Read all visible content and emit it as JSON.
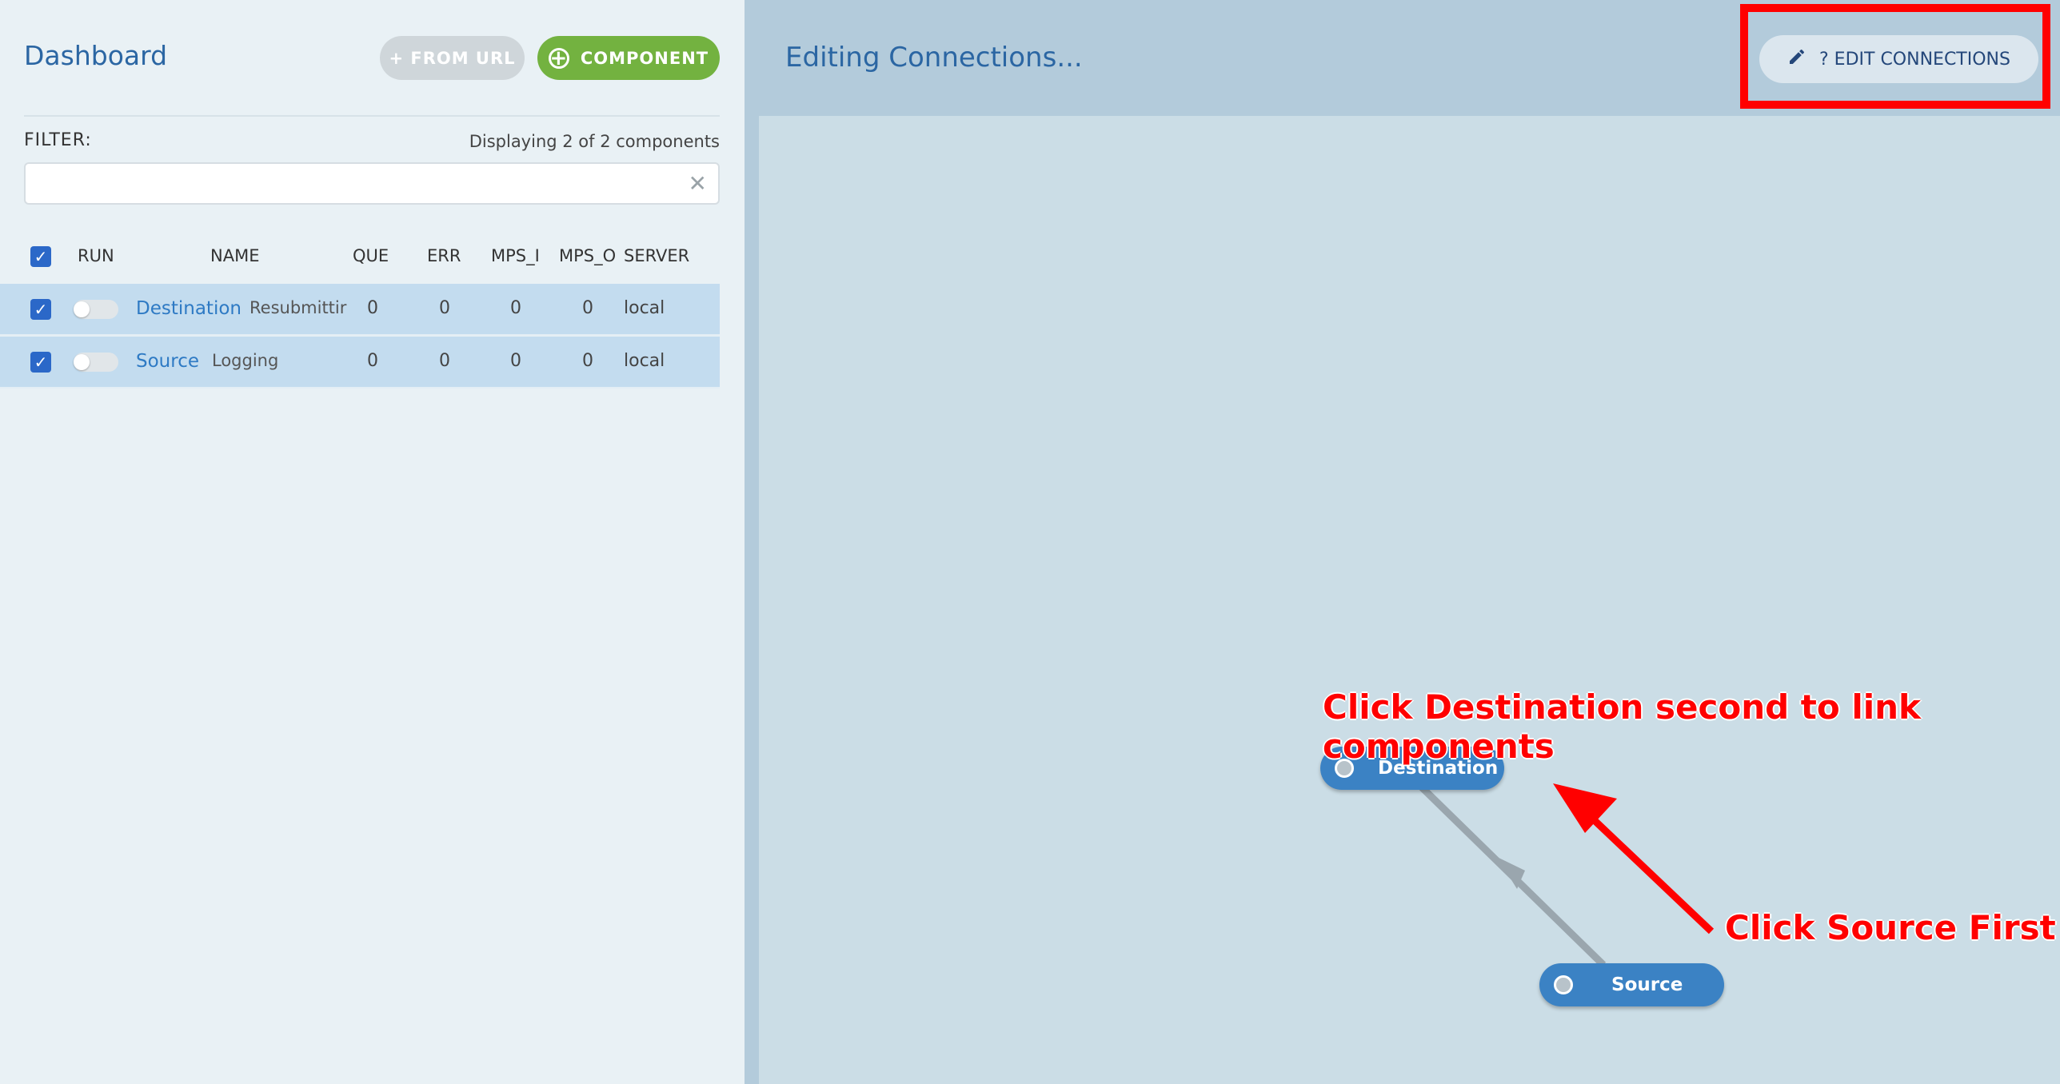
{
  "sidebar": {
    "title": "Dashboard",
    "from_url_label": "+ FROM URL",
    "component_label": "COMPONENT",
    "filter_label": "FILTER:",
    "display_count": "Displaying 2 of 2 components",
    "filter_value": ""
  },
  "table": {
    "headers": {
      "run": "RUN",
      "name": "NAME",
      "que": "QUE",
      "err": "ERR",
      "mps_i": "MPS_I",
      "mps_o": "MPS_O",
      "server": "SERVER"
    },
    "rows": [
      {
        "name": "Destination",
        "type": "Resubmittir",
        "que": "0",
        "err": "0",
        "mps_i": "0",
        "mps_o": "0",
        "server": "local",
        "checked": true,
        "running": false
      },
      {
        "name": "Source",
        "type": "Logging",
        "que": "0",
        "err": "0",
        "mps_i": "0",
        "mps_o": "0",
        "server": "local",
        "checked": true,
        "running": false
      }
    ]
  },
  "main": {
    "title": "Editing Connections...",
    "edit_button_label": "? EDIT CONNECTIONS",
    "nodes": {
      "destination": "Destination",
      "source": "Source"
    },
    "annotations": {
      "second": "Click Destination second to link components",
      "first": "Click Source First"
    }
  },
  "colors": {
    "accent_blue": "#2b66a3",
    "node_blue": "#3b82c4",
    "green": "#73b240",
    "annotation_red": "#ff0000"
  }
}
